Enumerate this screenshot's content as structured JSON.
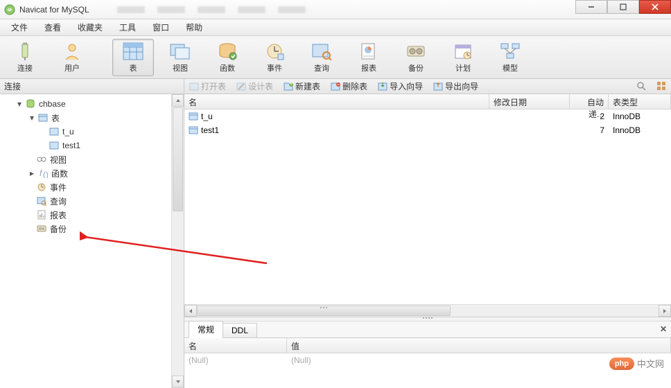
{
  "app_title": "Navicat for MySQL",
  "menubar": [
    "文件",
    "查看",
    "收藏夹",
    "工具",
    "窗口",
    "帮助"
  ],
  "toolbar": [
    {
      "id": "connect",
      "label": "连接"
    },
    {
      "id": "user",
      "label": "用户"
    },
    {
      "id": "table",
      "label": "表",
      "selected": true
    },
    {
      "id": "view",
      "label": "视图"
    },
    {
      "id": "function",
      "label": "函数"
    },
    {
      "id": "event",
      "label": "事件"
    },
    {
      "id": "query",
      "label": "查询"
    },
    {
      "id": "report",
      "label": "报表"
    },
    {
      "id": "backup",
      "label": "备份"
    },
    {
      "id": "schedule",
      "label": "计划"
    },
    {
      "id": "model",
      "label": "模型"
    }
  ],
  "left_header": "连接",
  "sub_toolbar": {
    "open_table": "打开表",
    "design_table": "设计表",
    "new_table": "新建表",
    "delete_table": "删除表",
    "import_wizard": "导入向导",
    "export_wizard": "导出向导"
  },
  "tree": {
    "db": "chbase",
    "tables_node": "表",
    "tables": [
      "t_u",
      "test1"
    ],
    "views": "视图",
    "functions": "函数",
    "events": "事件",
    "queries": "查询",
    "reports": "报表",
    "backups": "备份"
  },
  "table": {
    "columns": {
      "name": "名",
      "mod_date": "修改日期",
      "auto_inc": "自动递...",
      "type": "表类型"
    },
    "rows": [
      {
        "name": "t_u",
        "mod_date": "",
        "auto_inc": "2",
        "type": "InnoDB"
      },
      {
        "name": "test1",
        "mod_date": "",
        "auto_inc": "7",
        "type": "InnoDB"
      }
    ]
  },
  "bottom_tabs": {
    "general": "常规",
    "ddl": "DDL"
  },
  "detail": {
    "columns": {
      "name": "名",
      "value": "值"
    },
    "null_text": "(Null)"
  },
  "watermark": {
    "badge": "php",
    "text": "中文网"
  }
}
